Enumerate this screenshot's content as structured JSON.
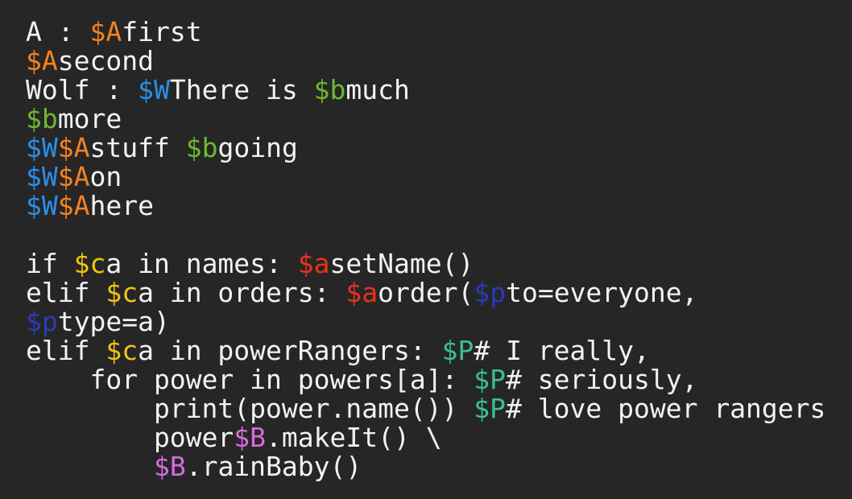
{
  "colors": {
    "background": "#262626",
    "default": "#f2f2f2",
    "A": "#f5821f",
    "W": "#2a8fe8",
    "b": "#6cb830",
    "c": "#f2c312",
    "a": "#e8321e",
    "p": "#2d3bb8",
    "P": "#3cbf96",
    "B": "#d86ae0"
  },
  "lines": [
    [
      {
        "t": "A : "
      },
      {
        "t": "$A",
        "c": "A"
      },
      {
        "t": "first"
      }
    ],
    [
      {
        "t": "$A",
        "c": "A"
      },
      {
        "t": "second"
      }
    ],
    [
      {
        "t": "Wolf : "
      },
      {
        "t": "$W",
        "c": "W"
      },
      {
        "t": "There is "
      },
      {
        "t": "$b",
        "c": "b"
      },
      {
        "t": "much"
      }
    ],
    [
      {
        "t": "$b",
        "c": "b"
      },
      {
        "t": "more"
      }
    ],
    [
      {
        "t": "$W",
        "c": "W"
      },
      {
        "t": "$A",
        "c": "A"
      },
      {
        "t": "stuff "
      },
      {
        "t": "$b",
        "c": "b"
      },
      {
        "t": "going"
      }
    ],
    [
      {
        "t": "$W",
        "c": "W"
      },
      {
        "t": "$A",
        "c": "A"
      },
      {
        "t": "on"
      }
    ],
    [
      {
        "t": "$W",
        "c": "W"
      },
      {
        "t": "$A",
        "c": "A"
      },
      {
        "t": "here"
      }
    ],
    [],
    [
      {
        "t": "if "
      },
      {
        "t": "$c",
        "c": "c"
      },
      {
        "t": "a in names: "
      },
      {
        "t": "$a",
        "c": "a"
      },
      {
        "t": "setName()"
      }
    ],
    [
      {
        "t": "elif "
      },
      {
        "t": "$c",
        "c": "c"
      },
      {
        "t": "a in orders: "
      },
      {
        "t": "$a",
        "c": "a"
      },
      {
        "t": "order("
      },
      {
        "t": "$p",
        "c": "p"
      },
      {
        "t": "to=everyone,"
      }
    ],
    [
      {
        "t": "$p",
        "c": "p"
      },
      {
        "t": "type=a)"
      }
    ],
    [
      {
        "t": "elif "
      },
      {
        "t": "$c",
        "c": "c"
      },
      {
        "t": "a in powerRangers: "
      },
      {
        "t": "$P",
        "c": "P"
      },
      {
        "t": "# I really,"
      }
    ],
    [
      {
        "t": "    for power in powers[a]: "
      },
      {
        "t": "$P",
        "c": "P"
      },
      {
        "t": "# seriously,"
      }
    ],
    [
      {
        "t": "        print(power.name()) "
      },
      {
        "t": "$P",
        "c": "P"
      },
      {
        "t": "# love power rangers"
      }
    ],
    [
      {
        "t": "        power"
      },
      {
        "t": "$B",
        "c": "B"
      },
      {
        "t": ".makeIt() \\"
      }
    ],
    [
      {
        "t": "        "
      },
      {
        "t": "$B",
        "c": "B"
      },
      {
        "t": ".rainBaby()"
      }
    ]
  ]
}
